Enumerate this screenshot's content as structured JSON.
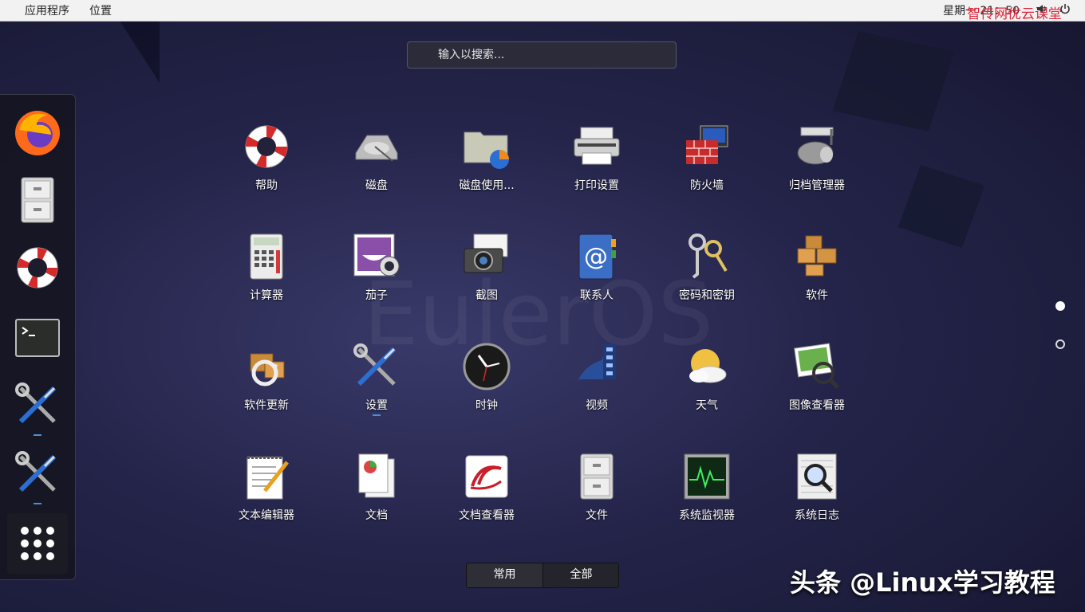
{
  "topbar": {
    "menus": [
      {
        "label": "应用程序"
      },
      {
        "label": "位置"
      }
    ],
    "clock": "星期一 21：50",
    "watermark": "智传网优云课堂",
    "tray": {
      "volume_icon": "volume-icon",
      "power_icon": "power-icon"
    }
  },
  "search": {
    "placeholder": "输入以搜索..."
  },
  "background": {
    "watermark": "EulerOS"
  },
  "dock": {
    "items": [
      {
        "name": "firefox",
        "icon": "firefox-icon"
      },
      {
        "name": "files",
        "icon": "file-cabinet-icon"
      },
      {
        "name": "help",
        "icon": "lifebuoy-icon"
      },
      {
        "name": "terminal",
        "icon": "terminal-icon"
      },
      {
        "name": "settings-1",
        "icon": "tools-icon",
        "running": true
      },
      {
        "name": "settings-2",
        "icon": "tools-icon",
        "running": true
      }
    ],
    "show_apps_icon": "apps-grid-icon"
  },
  "apps": [
    {
      "label": "帮助",
      "icon": "lifebuoy-icon"
    },
    {
      "label": "磁盘",
      "icon": "disk-icon"
    },
    {
      "label": "磁盘使用...",
      "icon": "disk-usage-icon"
    },
    {
      "label": "打印设置",
      "icon": "printer-icon"
    },
    {
      "label": "防火墙",
      "icon": "firewall-icon"
    },
    {
      "label": "归档管理器",
      "icon": "archive-icon"
    },
    {
      "label": "计算器",
      "icon": "calculator-icon"
    },
    {
      "label": "茄子",
      "icon": "webcam-icon"
    },
    {
      "label": "截图",
      "icon": "camera-icon"
    },
    {
      "label": "联系人",
      "icon": "contacts-icon"
    },
    {
      "label": "密码和密钥",
      "icon": "keys-icon"
    },
    {
      "label": "软件",
      "icon": "packages-icon"
    },
    {
      "label": "软件更新",
      "icon": "software-update-icon"
    },
    {
      "label": "设置",
      "icon": "tools-icon",
      "running": true
    },
    {
      "label": "时钟",
      "icon": "clock-icon"
    },
    {
      "label": "视频",
      "icon": "film-icon"
    },
    {
      "label": "天气",
      "icon": "weather-icon"
    },
    {
      "label": "图像查看器",
      "icon": "image-viewer-icon"
    },
    {
      "label": "文本编辑器",
      "icon": "text-editor-icon"
    },
    {
      "label": "文档",
      "icon": "documents-icon"
    },
    {
      "label": "文档查看器",
      "icon": "document-viewer-icon"
    },
    {
      "label": "文件",
      "icon": "file-cabinet-icon"
    },
    {
      "label": "系统监视器",
      "icon": "system-monitor-icon"
    },
    {
      "label": "系统日志",
      "icon": "system-log-icon"
    }
  ],
  "pagination": {
    "pages": 2,
    "current": 1
  },
  "view_toggle": {
    "frequent": "常用",
    "all": "全部",
    "active": "all"
  },
  "footer_watermark": "头条 @Linux学习教程",
  "colors": {
    "accent": "#4a90d9",
    "watermark_red": "#e0253a"
  }
}
